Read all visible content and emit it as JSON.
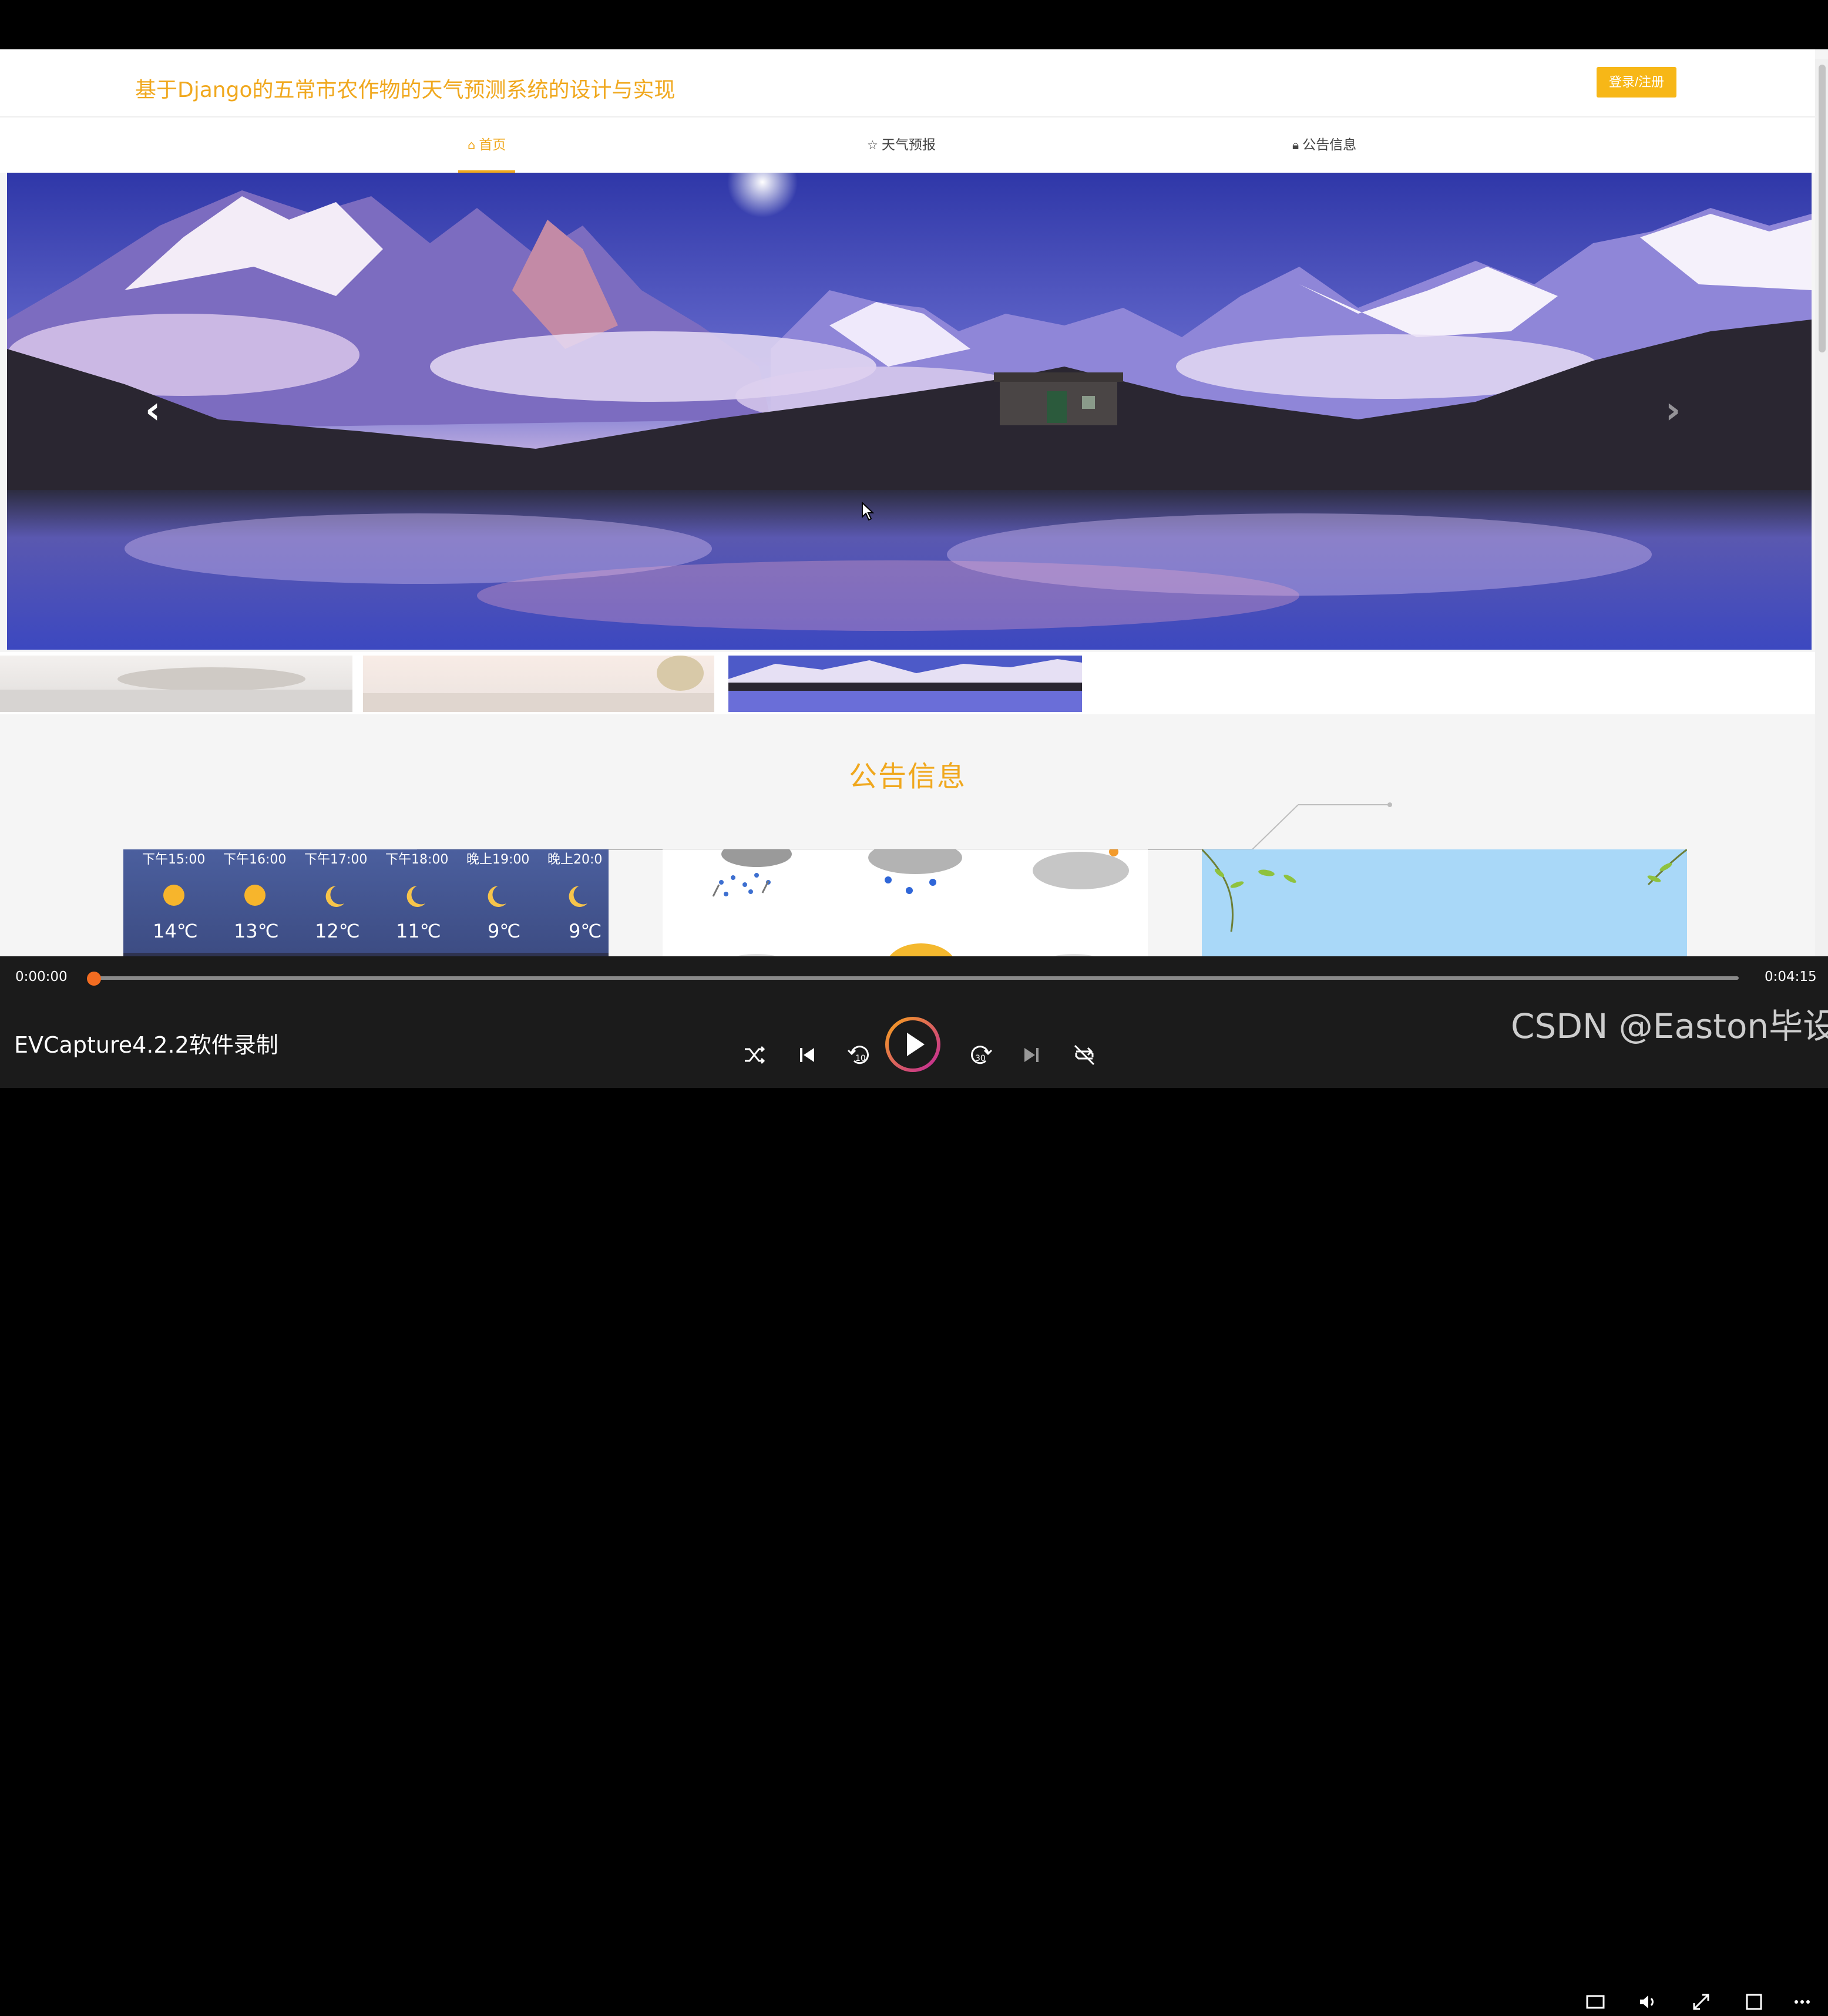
{
  "site": {
    "title": "基于Django的五常市农作物的天气预测系统的设计与实现",
    "login_label": "登录/注册"
  },
  "nav": {
    "items": [
      {
        "label": "首页",
        "icon": "home-icon",
        "active": true
      },
      {
        "label": "天气预报",
        "icon": "star-icon",
        "active": false
      },
      {
        "label": "公告信息",
        "icon": "lock-icon",
        "active": false
      }
    ]
  },
  "carousel": {
    "prev_icon": "chevron-left-icon",
    "next_icon": "chevron-right-icon",
    "thumbnail_count": 3,
    "active_thumbnail": 3
  },
  "section": {
    "title": "公告信息"
  },
  "cards": {
    "weather_forecast": {
      "hours": [
        "下午15:00",
        "下午16:00",
        "下午17:00",
        "下午18:00",
        "晚上19:00",
        "晚上20:0"
      ],
      "temps": [
        "14℃",
        "13℃",
        "12℃",
        "11℃",
        "9℃",
        "9℃"
      ]
    }
  },
  "player": {
    "current_time": "0:00:00",
    "total_time": "0:04:15",
    "progress": 0.0,
    "title": "EVCapture4.2.2软件录制",
    "accent": "#f26c21"
  },
  "watermark": "CSDN @Easton毕设",
  "colors": {
    "brand": "#f0a81e",
    "button": "#f7b717"
  }
}
